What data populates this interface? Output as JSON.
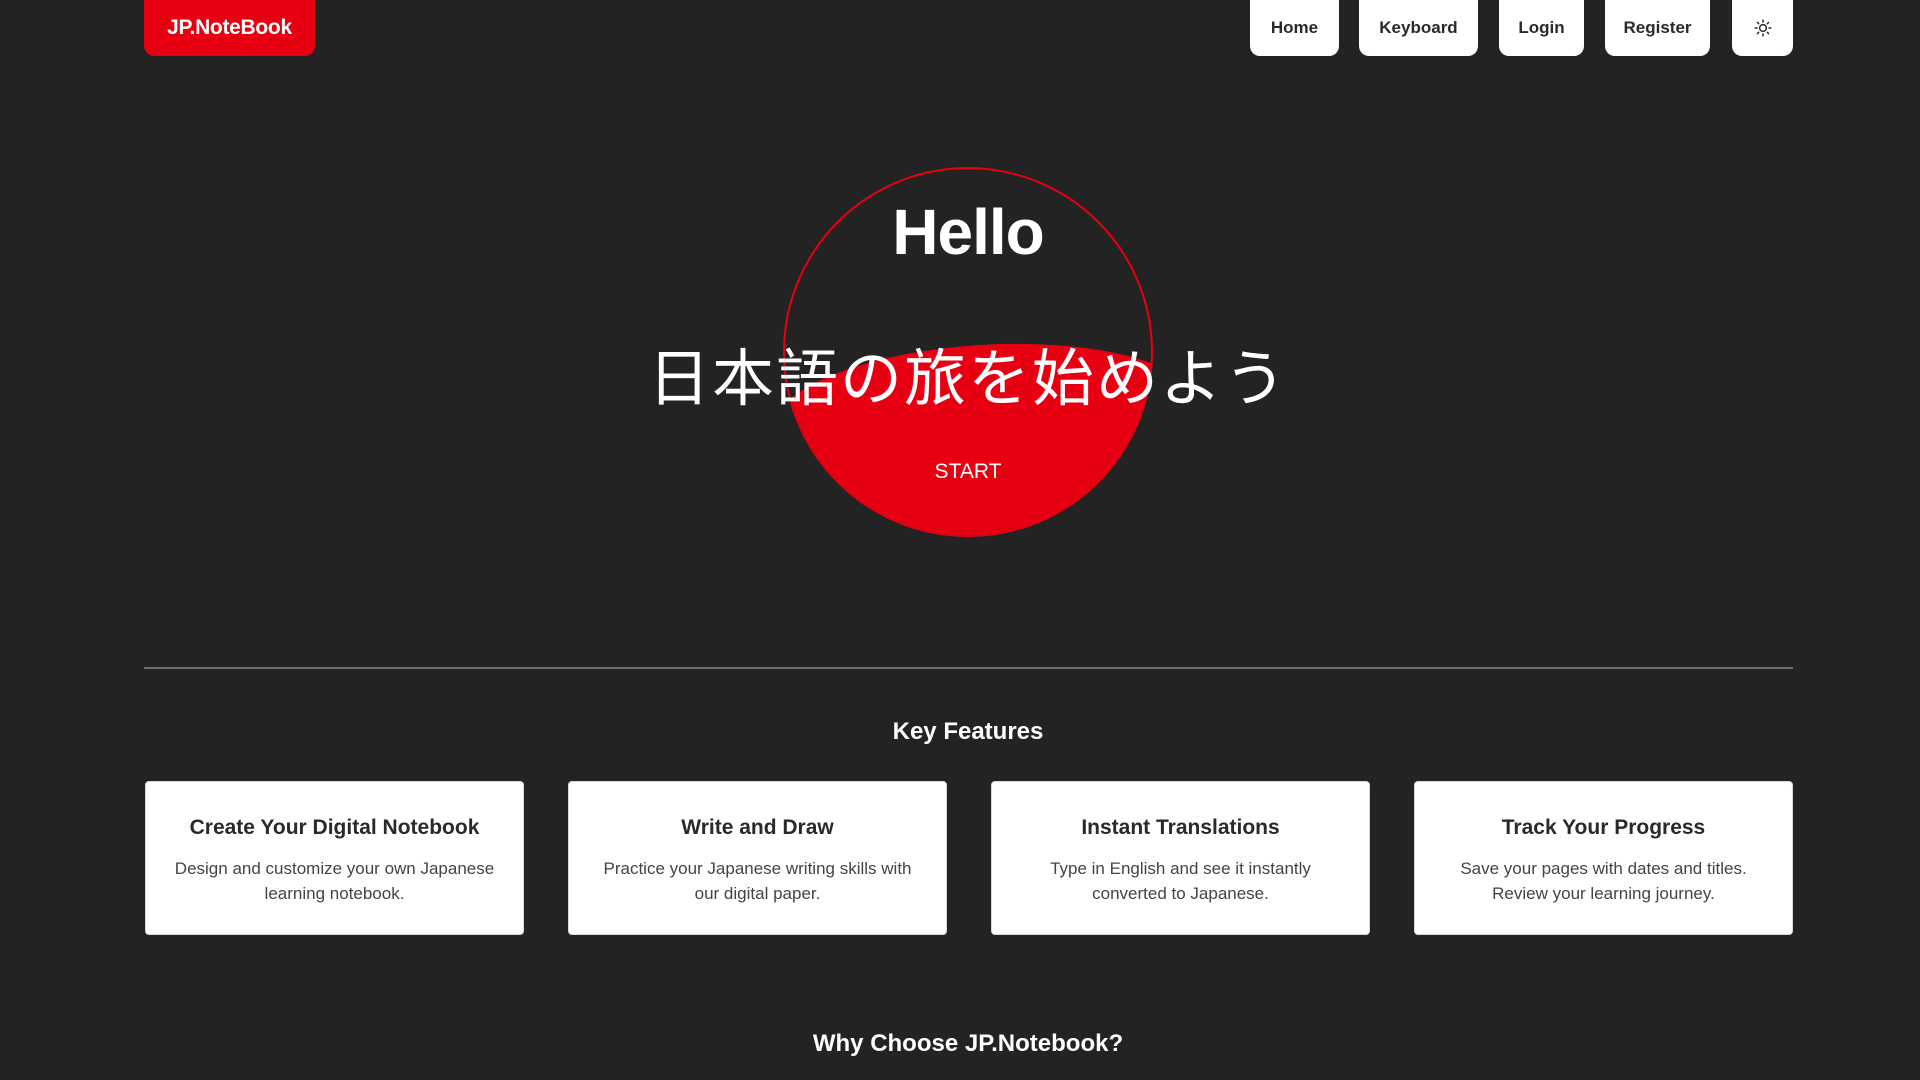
{
  "header": {
    "logo": "JP.NoteBook",
    "nav": {
      "home": "Home",
      "keyboard": "Keyboard",
      "login": "Login",
      "register": "Register"
    },
    "theme_icon": "sun-icon"
  },
  "hero": {
    "greeting": "Hello",
    "tagline_jp": "日本語の旅を始めよう",
    "start": "START"
  },
  "features": {
    "title": "Key Features",
    "cards": [
      {
        "title": "Create Your Digital Notebook",
        "desc": "Design and customize your own Japanese learning notebook."
      },
      {
        "title": "Write and Draw",
        "desc": "Practice your Japanese writing skills with our digital paper."
      },
      {
        "title": "Instant Translations",
        "desc": "Type in English and see it instantly converted to Japanese."
      },
      {
        "title": "Track Your Progress",
        "desc": "Save your pages with dates and titles. Review your learning journey."
      }
    ]
  },
  "why": {
    "title": "Why Choose JP.Notebook?"
  },
  "colors": {
    "background": "#232323",
    "accent": "#e60012",
    "card": "#ffffff"
  }
}
